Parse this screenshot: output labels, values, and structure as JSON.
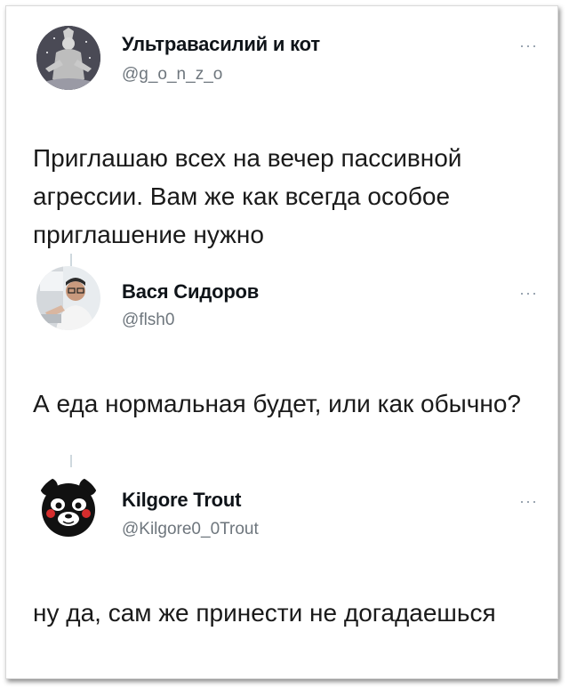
{
  "tweets": [
    {
      "name": "Ультравасилий и кот",
      "handle": "@g_o_n_z_o",
      "text": "Приглашаю всех на вечер пассивной агрессии. Вам же как всегда особое приглашение нужно",
      "more": "···"
    },
    {
      "name": "Вася Сидоров",
      "handle": "@flsh0",
      "text": "А еда нормальная будет, или как обычно?",
      "more": "···"
    },
    {
      "name": "Kilgore Trout",
      "handle": "@Kilgore0_0Trout",
      "text": "ну да, сам же принести не догадаешься",
      "more": "···"
    }
  ],
  "colors": {
    "text": "#0f1419",
    "handle": "#6e767d",
    "thread_line": "#cfd9de"
  }
}
